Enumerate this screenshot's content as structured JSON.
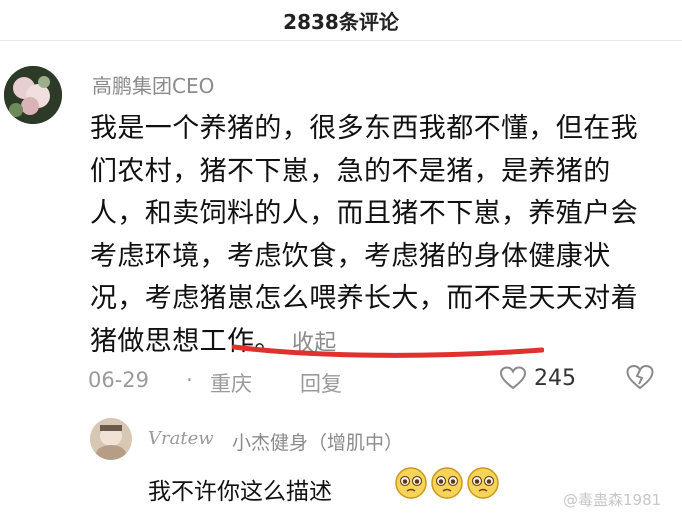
{
  "header": {
    "title": "2838条评论"
  },
  "comment": {
    "username": "高鹏集团CEO",
    "text": "我是一个养猪的，很多东西我都不懂，但在我们农村，猪不下崽，急的不是猪，是养猪的人，和卖饲料的人，而且猪不下崽，养殖户会考虑环境，考虑饮食，考虑猪的身体健康状况，考虑猪崽怎么喂养长大，而不是天天对着猪做思想工作。",
    "collapse_label": "收起",
    "date": "06-29",
    "separator": "·",
    "location": "重庆",
    "reply_label": "回复",
    "like_count": "245"
  },
  "reply": {
    "username_script": "Vratew",
    "username": "小杰健身（增肌中）",
    "text": "我不许你这么描述"
  },
  "watermark": "@毒蛊森1981",
  "colors": {
    "underline": "#e0312f",
    "meta": "#9a9a9a"
  },
  "icons": [
    "heart-icon",
    "broken-heart-icon",
    "pleading-face-emoji"
  ]
}
